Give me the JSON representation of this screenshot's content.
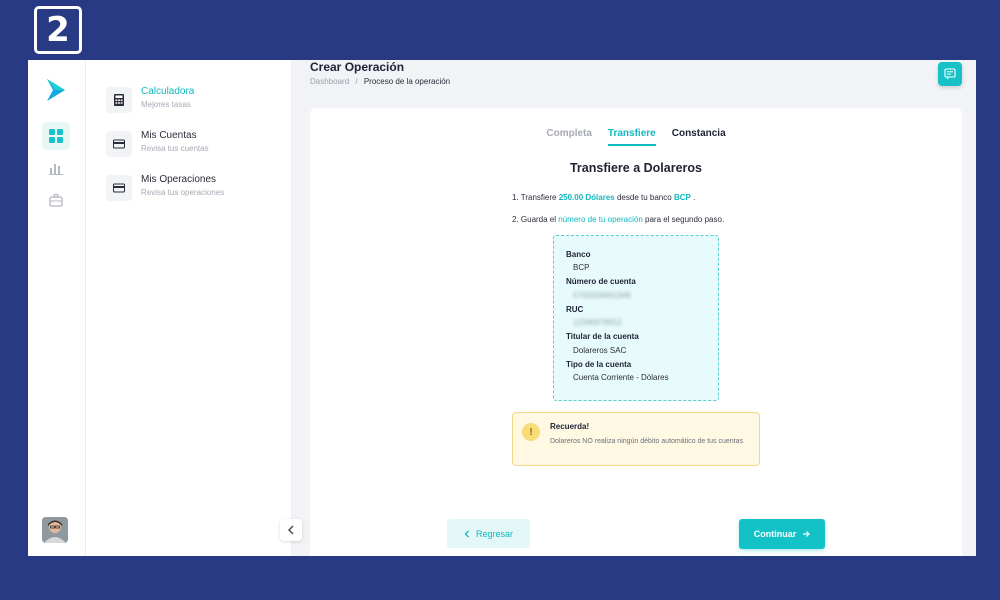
{
  "step_badge": "2",
  "colors": {
    "accent": "#12c2c6",
    "frame": "#283a84",
    "warning": "#f8dc75"
  },
  "rail": {
    "icons": [
      "dashboard-icon",
      "chart-icon",
      "briefcase-icon"
    ]
  },
  "nav": {
    "items": [
      {
        "title": "Calculadora",
        "subtitle": "Mejores tasas",
        "icon": "calculator-icon",
        "active": true
      },
      {
        "title": "Mis Cuentas",
        "subtitle": "Revisa tus cuentas",
        "icon": "card-icon",
        "active": false
      },
      {
        "title": "Mis Operaciones",
        "subtitle": "Revisa tus operaciones",
        "icon": "card-icon",
        "active": false
      }
    ]
  },
  "header": {
    "title": "Crear Operación",
    "breadcrumb_root": "Dashboard",
    "breadcrumb_sep": "/",
    "breadcrumb_current": "Proceso de la operación"
  },
  "tabs": {
    "completa": "Completa",
    "transfiere": "Transfiere",
    "constancia": "Constancia"
  },
  "main": {
    "heading": "Transfiere a Dolareros",
    "step1_prefix": "1. Transfiere",
    "step1_amount": "250.00 Dólares",
    "step1_mid": "desde tu banco",
    "step1_bank": "BCP",
    "step1_suffix": ".",
    "step2_prefix": "2. Guarda el",
    "step2_highlight": "número de tu operación",
    "step2_suffix": "para el segundo paso."
  },
  "account": {
    "bank_label": "Banco",
    "bank_value": "BCP",
    "number_label": "Número de cuenta",
    "number_value": "5700329401948",
    "ruc_label": "RUC",
    "ruc_value": "12345678912",
    "holder_label": "Titular de la cuenta",
    "holder_value": "Dolareros SAC",
    "type_label": "Tipo de la cuenta",
    "type_value": "Cuenta Corriente - Dólares"
  },
  "warning": {
    "icon": "!",
    "title": "Recuerda!",
    "text": "Dolareros NO realiza ningún débito automático de tus cuentas"
  },
  "buttons": {
    "back": "Regresar",
    "next": "Continuar"
  }
}
